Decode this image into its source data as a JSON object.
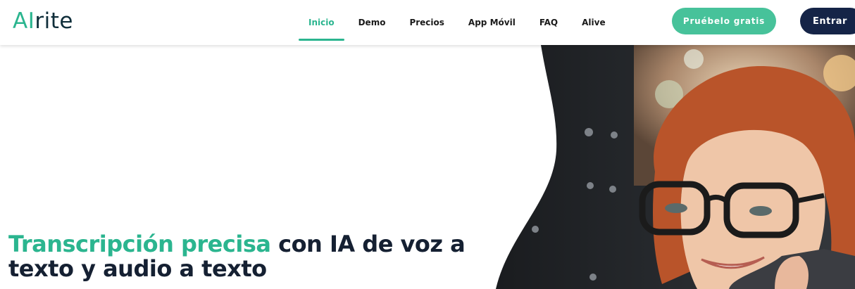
{
  "logo": {
    "prefix": "AI",
    "suffix": "rite"
  },
  "nav": {
    "items": [
      "Inicio",
      "Demo",
      "Precios",
      "App Móvil",
      "FAQ",
      "Alive"
    ],
    "active": "Inicio"
  },
  "cta": {
    "try_label": "Pruébelo gratis",
    "login_label": "Entrar"
  },
  "hero": {
    "headline_accent": "Transcripción precisa",
    "headline_rest": "con IA de voz a",
    "headline_line2": "texto y audio a texto"
  },
  "colors": {
    "accent": "#2bb58f",
    "button_green": "#47c29a",
    "button_dark": "#152447",
    "text_dark": "#152032"
  }
}
